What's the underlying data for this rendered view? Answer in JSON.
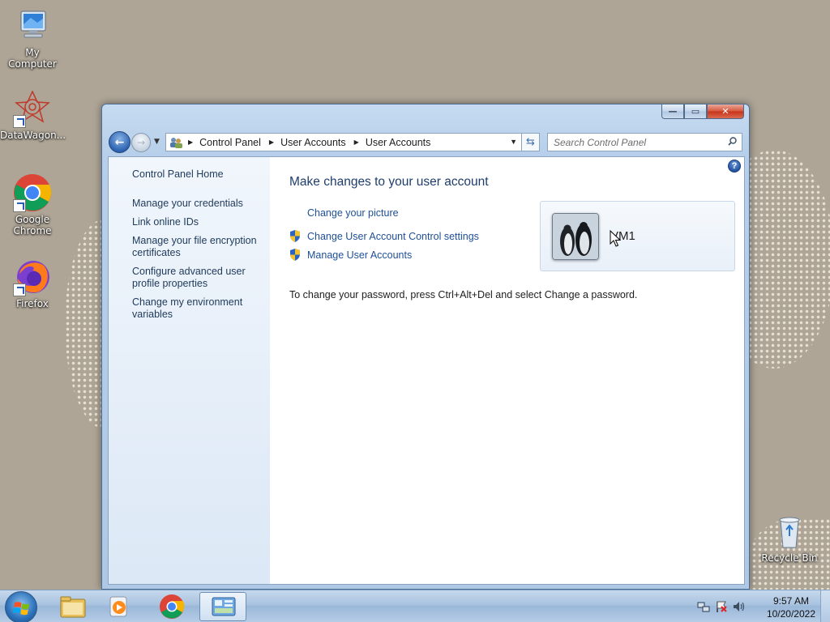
{
  "desktop": {
    "icons": [
      {
        "label": "My Computer"
      },
      {
        "label": "DataWagon..."
      },
      {
        "label": "Google Chrome"
      },
      {
        "label": "Firefox"
      },
      {
        "label": "Recycle Bin"
      }
    ]
  },
  "window": {
    "controls": {
      "minimize": "—",
      "maximize": "▭",
      "close": "✕"
    },
    "breadcrumb": [
      "Control Panel",
      "User Accounts",
      "User Accounts"
    ],
    "search": {
      "placeholder": "Search Control Panel"
    },
    "help": "?"
  },
  "sidebar": {
    "home": "Control Panel Home",
    "links": [
      "Manage your credentials",
      "Link online IDs",
      "Manage your file encryption certificates",
      "Configure advanced user profile properties",
      "Change my environment variables"
    ]
  },
  "main": {
    "title": "Make changes to your user account",
    "tasks": [
      {
        "label": "Change your picture",
        "shield": false
      },
      {
        "label": "Change User Account Control settings",
        "shield": true
      },
      {
        "label": "Manage User Accounts",
        "shield": true
      }
    ],
    "password_note": "To change your password, press Ctrl+Alt+Del and select Change a password.",
    "account": {
      "name": "VM1"
    }
  },
  "taskbar": {
    "clock": {
      "time": "9:57 AM",
      "date": "10/20/2022"
    }
  }
}
